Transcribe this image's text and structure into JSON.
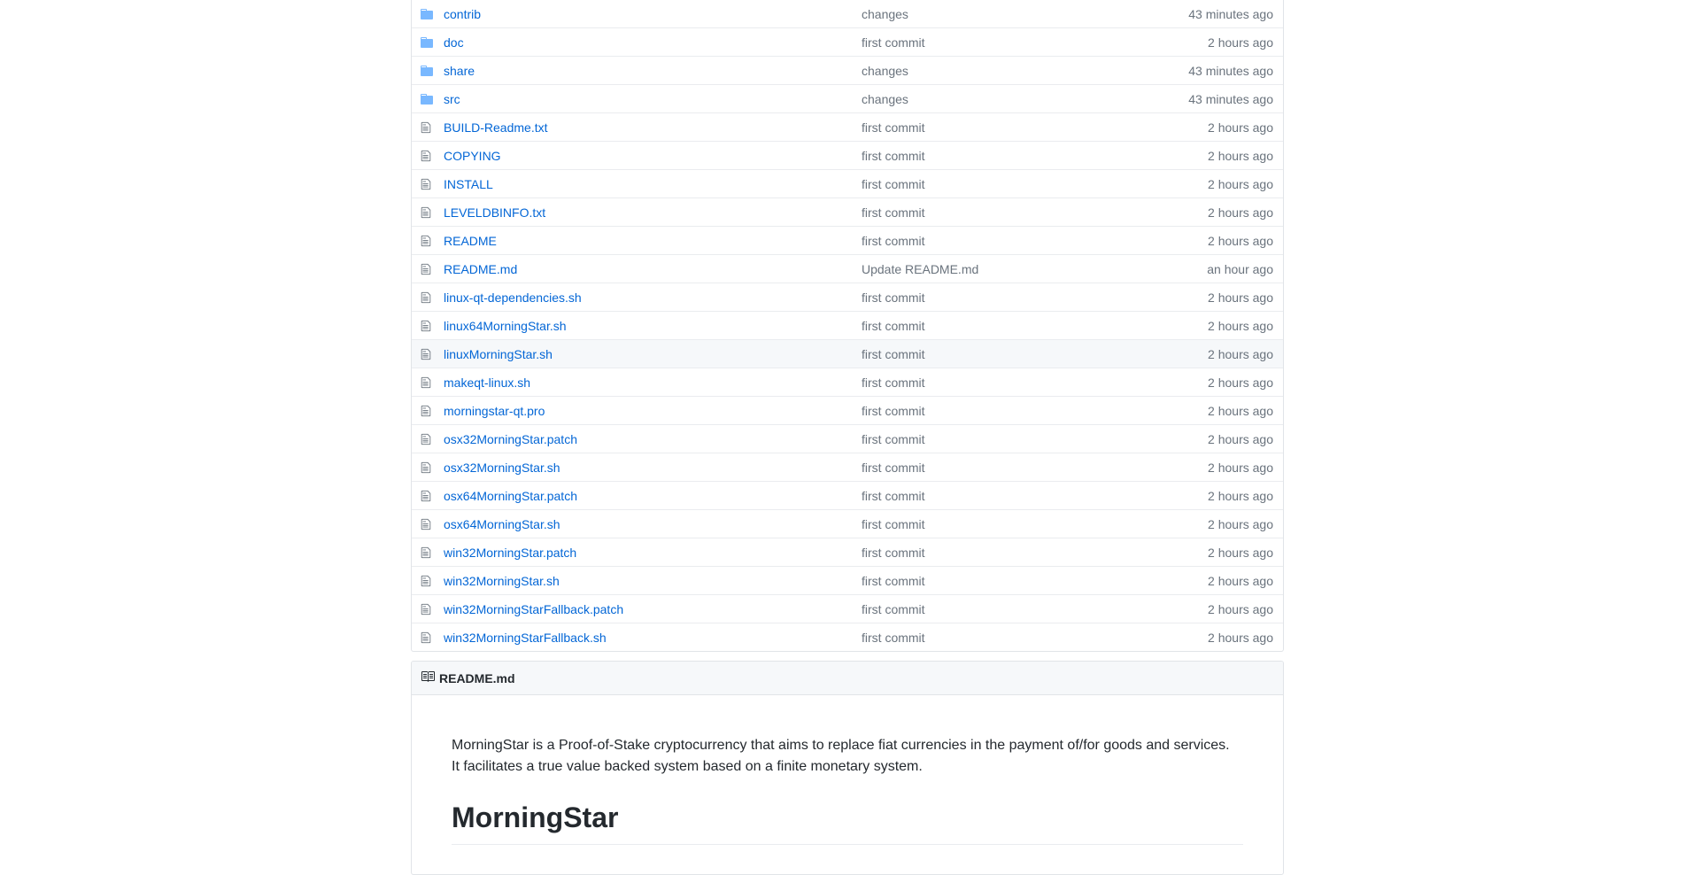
{
  "files": [
    {
      "type": "dir",
      "name": "contrib",
      "message": "changes",
      "age": "43 minutes ago"
    },
    {
      "type": "dir",
      "name": "doc",
      "message": "first commit",
      "age": "2 hours ago"
    },
    {
      "type": "dir",
      "name": "share",
      "message": "changes",
      "age": "43 minutes ago"
    },
    {
      "type": "dir",
      "name": "src",
      "message": "changes",
      "age": "43 minutes ago"
    },
    {
      "type": "file",
      "name": "BUILD-Readme.txt",
      "message": "first commit",
      "age": "2 hours ago"
    },
    {
      "type": "file",
      "name": "COPYING",
      "message": "first commit",
      "age": "2 hours ago"
    },
    {
      "type": "file",
      "name": "INSTALL",
      "message": "first commit",
      "age": "2 hours ago"
    },
    {
      "type": "file",
      "name": "LEVELDBINFO.txt",
      "message": "first commit",
      "age": "2 hours ago"
    },
    {
      "type": "file",
      "name": "README",
      "message": "first commit",
      "age": "2 hours ago"
    },
    {
      "type": "file",
      "name": "README.md",
      "message": "Update README.md",
      "age": "an hour ago"
    },
    {
      "type": "file",
      "name": "linux-qt-dependencies.sh",
      "message": "first commit",
      "age": "2 hours ago"
    },
    {
      "type": "file",
      "name": "linux64MorningStar.sh",
      "message": "first commit",
      "age": "2 hours ago"
    },
    {
      "type": "file",
      "name": "linuxMorningStar.sh",
      "message": "first commit",
      "age": "2 hours ago"
    },
    {
      "type": "file",
      "name": "makeqt-linux.sh",
      "message": "first commit",
      "age": "2 hours ago"
    },
    {
      "type": "file",
      "name": "morningstar-qt.pro",
      "message": "first commit",
      "age": "2 hours ago"
    },
    {
      "type": "file",
      "name": "osx32MorningStar.patch",
      "message": "first commit",
      "age": "2 hours ago"
    },
    {
      "type": "file",
      "name": "osx32MorningStar.sh",
      "message": "first commit",
      "age": "2 hours ago"
    },
    {
      "type": "file",
      "name": "osx64MorningStar.patch",
      "message": "first commit",
      "age": "2 hours ago"
    },
    {
      "type": "file",
      "name": "osx64MorningStar.sh",
      "message": "first commit",
      "age": "2 hours ago"
    },
    {
      "type": "file",
      "name": "win32MorningStar.patch",
      "message": "first commit",
      "age": "2 hours ago"
    },
    {
      "type": "file",
      "name": "win32MorningStar.sh",
      "message": "first commit",
      "age": "2 hours ago"
    },
    {
      "type": "file",
      "name": "win32MorningStarFallback.patch",
      "message": "first commit",
      "age": "2 hours ago"
    },
    {
      "type": "file",
      "name": "win32MorningStarFallback.sh",
      "message": "first commit",
      "age": "2 hours ago"
    }
  ],
  "hovered_row": "linuxMorningStar.sh",
  "readme": {
    "title": "README.md",
    "intro_line1": "MorningStar is a Proof-of-Stake cryptocurrency that aims to replace fiat currencies in the payment of/for goods and services.",
    "intro_line2": "It facilitates a true value backed system based on a finite monetary system.",
    "heading": "MorningStar"
  },
  "colors": {
    "link": "#0366d6",
    "muted": "#6a737d",
    "folder_icon": "#79b8ff",
    "file_icon": "#6a737d"
  }
}
